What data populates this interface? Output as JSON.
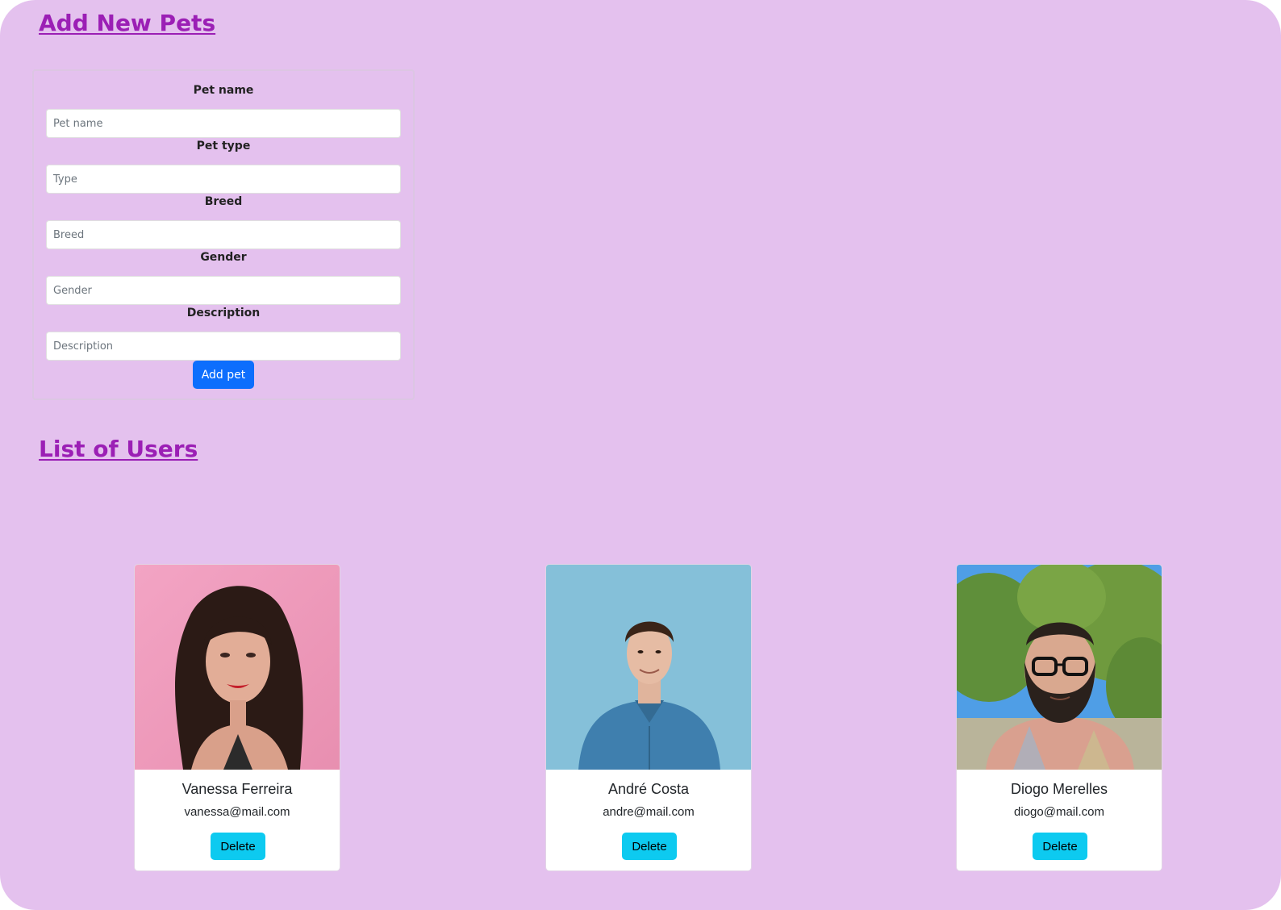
{
  "add_pets": {
    "heading": "Add New Pets",
    "fields": [
      {
        "label": "Pet name",
        "placeholder": "Pet name",
        "value": ""
      },
      {
        "label": "Pet type",
        "placeholder": "Type",
        "value": ""
      },
      {
        "label": "Breed",
        "placeholder": "Breed",
        "value": ""
      },
      {
        "label": "Gender",
        "placeholder": "Gender",
        "value": ""
      },
      {
        "label": "Description",
        "placeholder": "Description",
        "value": ""
      }
    ],
    "submit_label": "Add pet"
  },
  "users": {
    "heading": "List of Users",
    "items": [
      {
        "name": "Vanessa Ferreira",
        "email": "vanessa@mail.com",
        "delete_label": "Delete",
        "photo": "portrait-woman-pink-background"
      },
      {
        "name": "André Costa",
        "email": "andre@mail.com",
        "delete_label": "Delete",
        "photo": "portrait-man-blue-background"
      },
      {
        "name": "Diogo Merelles",
        "email": "diogo@mail.com",
        "delete_label": "Delete",
        "photo": "portrait-man-tree-background"
      }
    ]
  },
  "colors": {
    "background": "#e4c1ee",
    "heading": "#9b1fb5",
    "primary_button": "#0d6efd",
    "delete_button": "#0dcaf0"
  }
}
